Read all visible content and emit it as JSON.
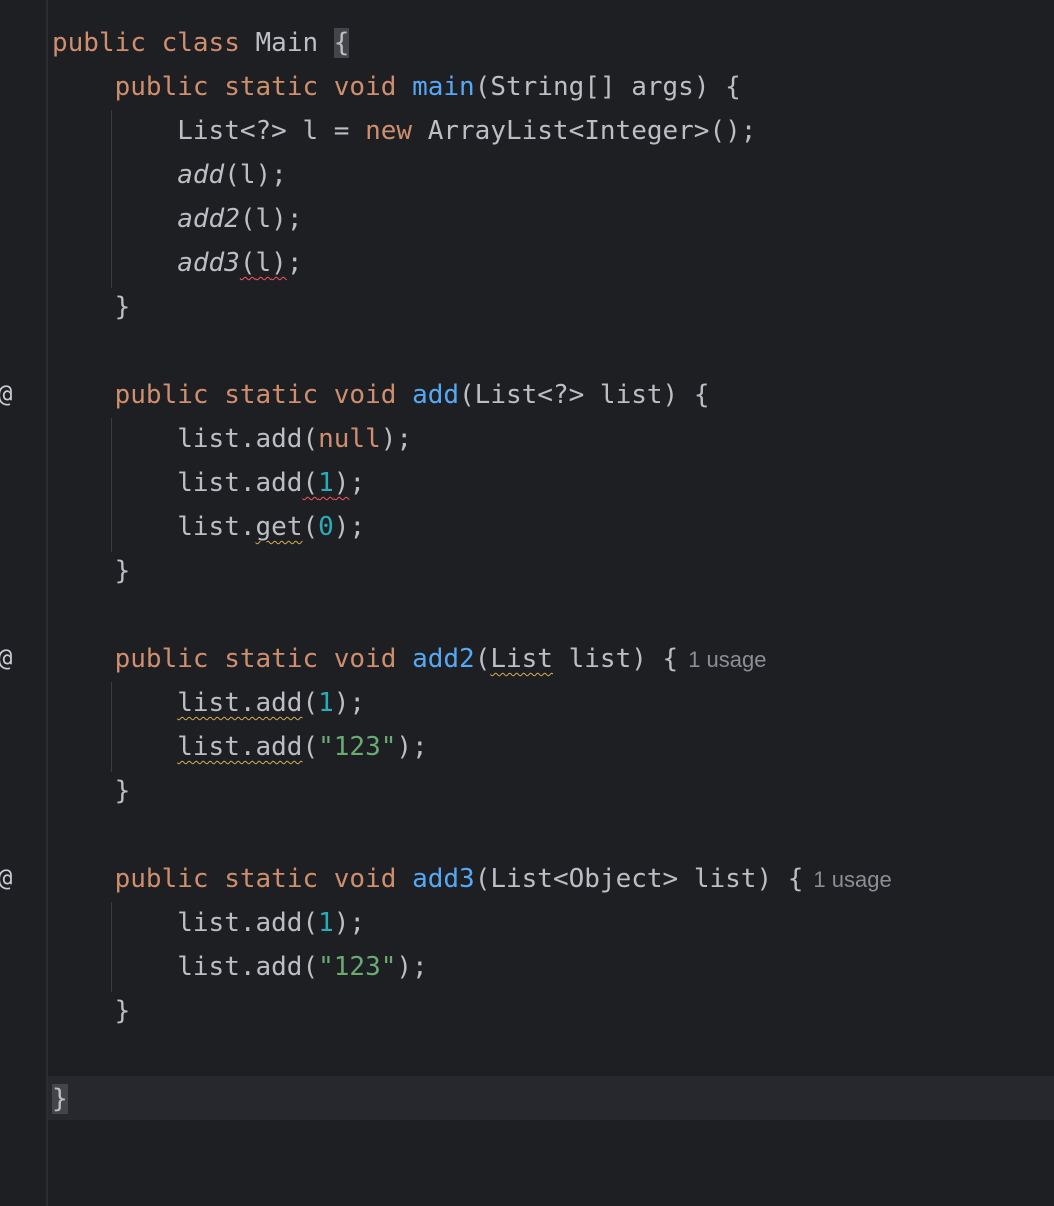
{
  "editor": {
    "gutter_marker": "@",
    "class_open": {
      "kw1": "public",
      "kw2": "class",
      "name": "Main",
      "brace": "{"
    },
    "main": {
      "kw1": "public",
      "kw2": "static",
      "kw3": "void",
      "name": "main",
      "params": "(String[] args) {",
      "l1_type": "List<?> l = ",
      "l1_new": "new",
      "l1_rest": " ArrayList<Integer>();",
      "l2_name": "add",
      "l2_rest": "(l);",
      "l3_name": "add2",
      "l3_rest": "(l);",
      "l4_name": "add3",
      "l4_paren": "(",
      "l4_arg": "l",
      "l4_close": ")",
      "l4_semi": ";",
      "close": "}"
    },
    "add": {
      "kw1": "public",
      "kw2": "static",
      "kw3": "void",
      "name": "add",
      "params": "(List<?> list) {",
      "l1_a": "list.add(",
      "l1_null": "null",
      "l1_b": ");",
      "l2_a": "list.add",
      "l2_p": "(",
      "l2_num": "1",
      "l2_c": ")",
      "l2_b": ";",
      "l3_a": "list.",
      "l3_get": "get",
      "l3_p": "(",
      "l3_num": "0",
      "l3_b": ");",
      "close": "}"
    },
    "add2": {
      "kw1": "public",
      "kw2": "static",
      "kw3": "void",
      "name": "add2",
      "p_open": "(",
      "p_type": "List",
      "p_rest": " list) {",
      "usage": "1 usage",
      "l1_a": "list.add",
      "l1_p": "(",
      "l1_num": "1",
      "l1_b": ");",
      "l2_a": "list.add",
      "l2_p": "(",
      "l2_str": "\"123\"",
      "l2_b": ");",
      "close": "}"
    },
    "add3": {
      "kw1": "public",
      "kw2": "static",
      "kw3": "void",
      "name": "add3",
      "params": "(List<Object> list) {",
      "usage": "1 usage",
      "l1_a": "list.add(",
      "l1_num": "1",
      "l1_b": ");",
      "l2_a": "list.add(",
      "l2_str": "\"123\"",
      "l2_b": ");",
      "close": "}"
    },
    "class_close": "}"
  }
}
